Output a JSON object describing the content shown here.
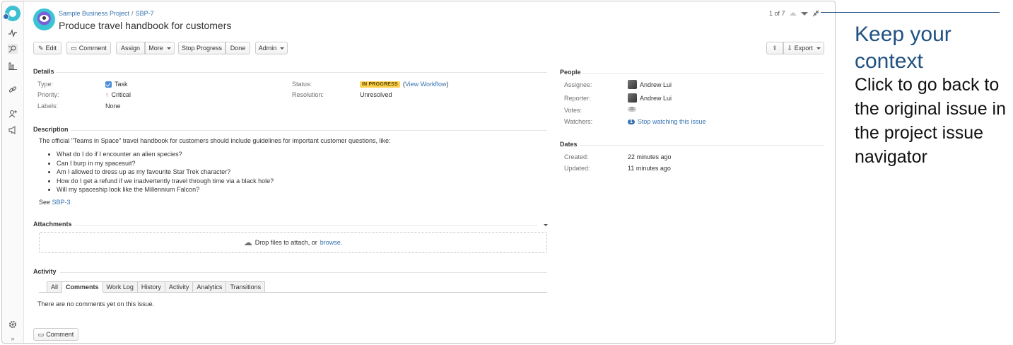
{
  "breadcrumb": {
    "project": "Sample Business Project",
    "separator": "/",
    "issue_key": "SBP-7"
  },
  "issue": {
    "title": "Produce travel handbook for customers"
  },
  "pager": {
    "position": "1 of 7"
  },
  "toolbar": {
    "edit": "Edit",
    "comment": "Comment",
    "assign": "Assign",
    "more": "More",
    "stop_progress": "Stop Progress",
    "done": "Done",
    "admin": "Admin",
    "export": "Export"
  },
  "details": {
    "heading": "Details",
    "type_label": "Type:",
    "type_value": "Task",
    "priority_label": "Priority:",
    "priority_value": "Critical",
    "labels_label": "Labels:",
    "labels_value": "None",
    "status_label": "Status:",
    "status_value": "IN PROGRESS",
    "view_workflow": "View Workflow",
    "status_color": "#ffd351",
    "resolution_label": "Resolution:",
    "resolution_value": "Unresolved"
  },
  "people": {
    "heading": "People",
    "assignee_label": "Assignee:",
    "assignee": "Andrew Lui",
    "reporter_label": "Reporter:",
    "reporter": "Andrew Lui",
    "votes_label": "Votes:",
    "votes": "0",
    "watchers_label": "Watchers:",
    "watchers_count": "1",
    "watch_link": "Stop watching this issue"
  },
  "dates": {
    "heading": "Dates",
    "created_label": "Created:",
    "created": "22 minutes ago",
    "updated_label": "Updated:",
    "updated": "11 minutes ago"
  },
  "description": {
    "heading": "Description",
    "intro": "The official \"Teams in Space\" travel handbook for customers should include guidelines for important customer questions, like:",
    "items": [
      "What do I do if I encounter an alien species?",
      "Can I burp in my spacesuit?",
      "Am I allowed to dress up as my favourite Star Trek character?",
      "How do I get a refund if we inadvertently travel through time via a black hole?",
      "Will my spaceship look like the Millennium Falcon?"
    ],
    "see_prefix": "See",
    "see_link": "SBP-3"
  },
  "attachments": {
    "heading": "Attachments",
    "drop_text": "Drop files to attach, or",
    "browse": "browse."
  },
  "activity": {
    "heading": "Activity",
    "tabs": [
      "All",
      "Comments",
      "Work Log",
      "History",
      "Activity",
      "Analytics",
      "Transitions"
    ],
    "active_tab": "Comments",
    "empty": "There are no comments yet on this issue.",
    "comment_button": "Comment"
  },
  "callout": {
    "title": "Keep your context",
    "body": "Click to go back to the original issue in the project issue navigator"
  },
  "colors": {
    "link": "#3572b0",
    "callout_title": "#205081"
  }
}
